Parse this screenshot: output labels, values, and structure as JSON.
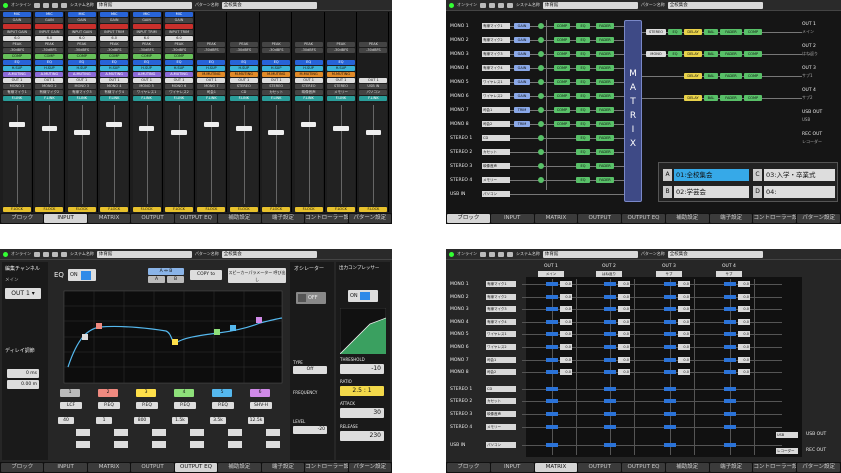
{
  "status": {
    "online": "オンライン",
    "system_label": "システム名称",
    "system_name": "体育館",
    "pattern_label": "パターン名称",
    "pattern_name": "全校集会"
  },
  "tabs": [
    "ブロック",
    "INPUT",
    "MATRIX",
    "OUTPUT",
    "OUTPUT EQ",
    "補助設定",
    "端子設定",
    "コントローラー設定",
    "パターン設定"
  ],
  "input_panel": {
    "channels": [
      {
        "mode": "MIC",
        "gain": "GAIN",
        "trim_label": "INPUT GAIN",
        "trim": "6.0",
        "peak": "PEAK",
        "peak_val": "-30dBFS",
        "comp": "COMP",
        "eq": "EQ",
        "hsup": "H.SUP",
        "amute": "A.MUTING",
        "out": "OUT 1",
        "name": "MONO 1",
        "sub": "有線マイク1",
        "link": "F.LINK",
        "lock": "F.LOCK"
      },
      {
        "mode": "MIC",
        "gain": "GAIN",
        "trim_label": "INPUT GAIN",
        "trim": "6.0",
        "peak": "PEAK",
        "peak_val": "-30dBFS",
        "comp": "COMP",
        "eq": "EQ",
        "hsup": "H.SUP",
        "amute": "A.MUTING",
        "out": "OUT 1",
        "name": "MONO 2",
        "sub": "有線マイク2",
        "link": "F.LINK",
        "lock": "F.LOCK"
      },
      {
        "mode": "MIC",
        "gain": "GAIN",
        "trim_label": "INPUT GAIN",
        "trim": "6.0",
        "peak": "PEAK",
        "peak_val": "-30dBFS",
        "comp": "COMP",
        "eq": "EQ",
        "hsup": "H.SUP",
        "amute": "A.MUTING",
        "out": "OUT 1",
        "name": "MONO 3",
        "sub": "有線マイク3",
        "link": "F.LINK",
        "lock": "F.LOCK"
      },
      {
        "mode": "MIC",
        "gain": "GAIN",
        "trim_label": "INPUT TRIM",
        "trim": "6.0",
        "peak": "PEAK",
        "peak_val": "-30dBFS",
        "comp": "COMP",
        "eq": "EQ",
        "hsup": "H.SUP",
        "amute": "A.MUTING",
        "out": "OUT 1",
        "name": "MONO 4",
        "sub": "有線マイク4",
        "link": "F.LINK",
        "lock": "F.LOCK"
      },
      {
        "mode": "MIC",
        "gain": "GAIN",
        "trim_label": "INPUT TRIM",
        "trim": "6.0",
        "peak": "PEAK",
        "peak_val": "-30dBFS",
        "comp": "COMP",
        "eq": "EQ",
        "hsup": "H.SUP",
        "amute": "A.MUTING",
        "out": "OUT 1",
        "name": "MONO 5",
        "sub": "ワイヤレス1",
        "link": "F.LINK",
        "lock": "F.LOCK"
      },
      {
        "mode": "MIC",
        "gain": "GAIN",
        "trim_label": "INPUT TRIM",
        "trim": "6.0",
        "peak": "PEAK",
        "peak_val": "-30dBFS",
        "comp": "COMP",
        "eq": "EQ",
        "hsup": "H.SUP",
        "amute": "A.MUTING",
        "out": "OUT 1",
        "name": "MONO 6",
        "sub": "ワイヤレス2",
        "link": "F.LINK",
        "lock": "F.LOCK"
      },
      {
        "mode": "",
        "gain": "",
        "trim_label": "",
        "trim": "",
        "peak": "PEAK",
        "peak_val": "-30dBFS",
        "comp": "",
        "eq": "EQ",
        "hsup": "H.SUP",
        "amute": "M.MUTING",
        "out": "OUT 1",
        "name": "MONO 7",
        "sub": "司会1",
        "link": "F.LINK",
        "lock": "F.LOCK"
      },
      {
        "mode": "",
        "gain": "",
        "trim_label": "",
        "trim": "",
        "peak": "PEAK",
        "peak_val": "-30dBFS",
        "comp": "",
        "eq": "EQ",
        "hsup": "H.SUP",
        "amute": "M.MUTING",
        "out": "OUT 1",
        "name": "STEREO",
        "sub": "CD",
        "link": "F.LINK",
        "lock": "F.LOCK"
      },
      {
        "mode": "",
        "gain": "",
        "trim_label": "",
        "trim": "",
        "peak": "PEAK",
        "peak_val": "-30dBFS",
        "comp": "",
        "eq": "EQ",
        "hsup": "H.SUP",
        "amute": "M.MUTING",
        "out": "OUT 1",
        "name": "STEREO",
        "sub": "カセット",
        "link": "F.LINK",
        "lock": "F.LOCK"
      },
      {
        "mode": "",
        "gain": "",
        "trim_label": "",
        "trim": "",
        "peak": "PEAK",
        "peak_val": "-30dBFS",
        "comp": "",
        "eq": "EQ",
        "hsup": "H.SUP",
        "amute": "M.MUTING",
        "out": "OUT 1",
        "name": "STEREO",
        "sub": "映像音声",
        "link": "F.LINK",
        "lock": "F.LOCK"
      },
      {
        "mode": "",
        "gain": "",
        "trim_label": "",
        "trim": "",
        "peak": "PEAK",
        "peak_val": "-30dBFS",
        "comp": "",
        "eq": "EQ",
        "hsup": "H.SUP",
        "amute": "M.MUTING",
        "out": "OUT 1",
        "name": "STEREO",
        "sub": "メモリー",
        "link": "F.LINK",
        "lock": "F.LOCK"
      },
      {
        "mode": "",
        "gain": "",
        "trim_label": "",
        "trim": "",
        "peak": "PEAK",
        "peak_val": "-30dBFS",
        "comp": "",
        "eq": "",
        "hsup": "",
        "amute": "",
        "out": "OUT 1",
        "name": "USB IN",
        "sub": "パソコン",
        "link": "F.LINK",
        "lock": "F.LOCK"
      }
    ]
  },
  "block_panel": {
    "inputs": [
      {
        "name": "MONO 1",
        "sub": "有線マイク1"
      },
      {
        "name": "MONO 2",
        "sub": "有線マイク2"
      },
      {
        "name": "MONO 3",
        "sub": "有線マイク3"
      },
      {
        "name": "MONO 4",
        "sub": "有線マイク4"
      },
      {
        "name": "MONO 5",
        "sub": "ワイヤレス1"
      },
      {
        "name": "MONO 6",
        "sub": "ワイヤレス2"
      },
      {
        "name": "MONO 7",
        "sub": "司会1"
      },
      {
        "name": "MONO 8",
        "sub": "司会2"
      },
      {
        "name": "STEREO 1",
        "sub": "CD"
      },
      {
        "name": "STEREO 2",
        "sub": "カセット"
      },
      {
        "name": "STEREO 3",
        "sub": "映像音声"
      },
      {
        "name": "STEREO 4",
        "sub": "メモリー"
      },
      {
        "name": "USB IN",
        "sub": "パソコン"
      }
    ],
    "blocks": {
      "gain": "GAIN",
      "trim": "TRIM",
      "comp": "COMP",
      "eq": "EQ",
      "fader": "FADER",
      "delay": "DELAY",
      "bal": "BAL",
      "stereo": "STEREO",
      "mono": "MONO"
    },
    "matrix_label": "MATRIX",
    "outputs": [
      {
        "name": "OUT 1",
        "sub": "メイン"
      },
      {
        "name": "OUT 2",
        "sub": "はね返り"
      },
      {
        "name": "OUT 3",
        "sub": "サブ1"
      },
      {
        "name": "OUT 4",
        "sub": "サブ2"
      },
      {
        "name": "USB OUT",
        "sub": "USB"
      },
      {
        "name": "REC OUT",
        "sub": "レコーダー"
      }
    ],
    "patterns": [
      {
        "key": "A",
        "name": "01:全校集会"
      },
      {
        "key": "B",
        "name": "02:学芸会"
      },
      {
        "key": "C",
        "name": "03:入学・卒業式"
      },
      {
        "key": "D",
        "name": "04:"
      }
    ]
  },
  "eq_panel": {
    "edit_channel": "編集チャンネル",
    "main": "メイン",
    "out_select": "OUT 1",
    "delay": "ディレイ調節",
    "delay_ms": "0 ms",
    "delay_m": "0.00 m",
    "eq": "EQ",
    "on": "ON",
    "ab": "A ⇔ B",
    "a": "A",
    "b": "B",
    "copy": "COPY to",
    "speaker": "スピーカーパラメーター 呼び出し",
    "oscillator": "オシレーター",
    "compressor": "出力コンプレッサー",
    "off": "OFF",
    "type_label": "TYPE",
    "type": "Off",
    "freq_label": "FREQUENCY",
    "level_label": "LEVEL",
    "level": "-20",
    "threshold_label": "THRESHOLD",
    "threshold": "-10",
    "ratio_label": "RATIO",
    "ratio": "2.5 : 1",
    "attack_label": "ATTACK",
    "attack": "30",
    "release_label": "RELEASE",
    "release": "230",
    "bands": [
      {
        "n": "1",
        "type": "LCF",
        "g": "40"
      },
      {
        "n": "2",
        "type": "P.EQ",
        "g": "1"
      },
      {
        "n": "3",
        "type": "P.EQ",
        "g": "800"
      },
      {
        "n": "4",
        "type": "P.EQ",
        "g": "1.5k"
      },
      {
        "n": "5",
        "type": "P.EQ",
        "g": "3.5k"
      },
      {
        "n": "6",
        "type": "SHV-H",
        "g": "12.5k"
      }
    ]
  },
  "matrix_panel": {
    "outputs": [
      {
        "name": "OUT 1",
        "sub": "メイン"
      },
      {
        "name": "OUT 2",
        "sub": "はね返り"
      },
      {
        "name": "OUT 3",
        "sub": "サブ"
      },
      {
        "name": "OUT 4",
        "sub": "サブ"
      }
    ],
    "rows": [
      {
        "name": "MONO 1",
        "sub": "有線マイク1"
      },
      {
        "name": "MONO 2",
        "sub": "有線マイク2"
      },
      {
        "name": "MONO 3",
        "sub": "有線マイク3"
      },
      {
        "name": "MONO 4",
        "sub": "有線マイク4"
      },
      {
        "name": "MONO 5",
        "sub": "ワイヤレス1"
      },
      {
        "name": "MONO 6",
        "sub": "ワイヤレス2"
      },
      {
        "name": "MONO 7",
        "sub": "司会1"
      },
      {
        "name": "MONO 8",
        "sub": "司会2"
      },
      {
        "name": "STEREO 1",
        "sub": "CD"
      },
      {
        "name": "STEREO 2",
        "sub": "カセット"
      },
      {
        "name": "STEREO 3",
        "sub": "映像音声"
      },
      {
        "name": "STEREO 4",
        "sub": "メモリー"
      },
      {
        "name": "USB IN",
        "sub": "パソコン"
      }
    ],
    "value": "0.0",
    "usb_out": "USB OUT",
    "usb": "USB",
    "rec_out": "REC OUT",
    "rec": "レコーダー"
  },
  "colors": {
    "blue": "#2864d8",
    "green_led": "#33ff33",
    "yellow": "#e7c12c"
  }
}
